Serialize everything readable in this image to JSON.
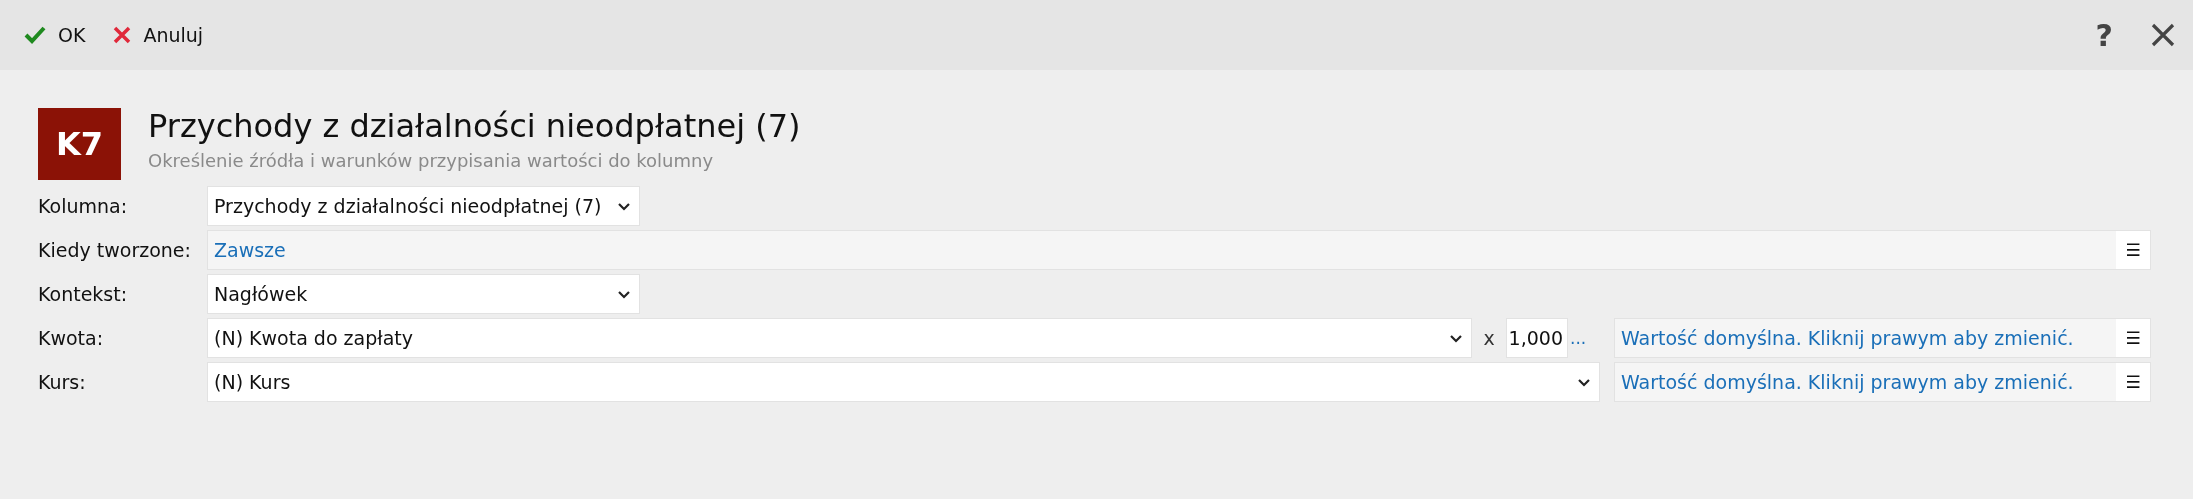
{
  "toolbar": {
    "actions": [
      {
        "kind": "ok",
        "label": "OK"
      },
      {
        "kind": "cancel",
        "label": "Anuluj"
      }
    ],
    "help": "?"
  },
  "header": {
    "badge": "K7",
    "title": "Przychody z działalności nieodpłatnej (7)",
    "subtitle": "Określenie źródła i warunków przypisania wartości do kolumny"
  },
  "rows": [
    {
      "kind": "select",
      "label": "Kolumna:",
      "value": "Przychody z działalności nieodpłatnej (7)"
    },
    {
      "kind": "link",
      "label": "Kiedy tworzone:",
      "value": "Zawsze",
      "menu": "☰"
    },
    {
      "kind": "select",
      "label": "Kontekst:",
      "value": "Nagłówek"
    },
    {
      "kind": "amount",
      "label": "Kwota:",
      "value": "(N) Kwota do zapłaty",
      "multiplier": "x",
      "factor": "1,000",
      "more": "...",
      "note": "Wartość domyślna. Kliknij prawym aby zmienić.",
      "menu": "☰"
    },
    {
      "kind": "rate",
      "label": "Kurs:",
      "value": "(N) Kurs",
      "note": "Wartość domyślna. Kliknij prawym aby zmienić.",
      "menu": "☰"
    }
  ]
}
